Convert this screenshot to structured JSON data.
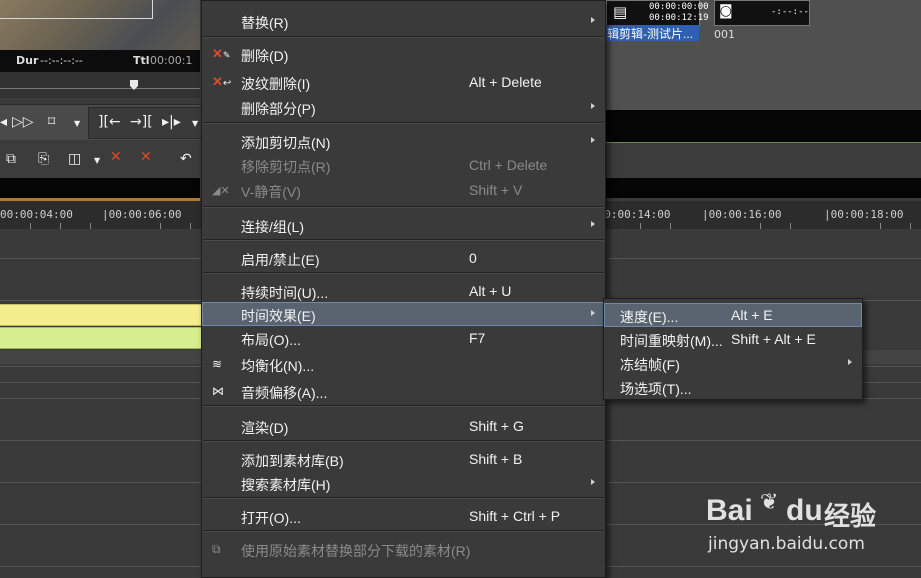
{
  "preview": {
    "dur_label": "Dur",
    "dur_value": "--:--:--:--",
    "ttl_label": "Ttl",
    "ttl_value": "00:00:1"
  },
  "ruler": {
    "labels": [
      "00:00:04:00",
      "|00:00:06:00",
      "|00:00:14:00",
      "|00:00:16:00",
      "|00:00:18:00"
    ]
  },
  "thumbnails": [
    {
      "time1": "00:00:00:00",
      "time2": "00:00:12:19",
      "caption": "辑剪辑-测试片..."
    },
    {
      "time1": "-:--:--",
      "time2": "",
      "caption": "001"
    }
  ],
  "context_menu": {
    "items": [
      {
        "label": "替换(R)",
        "shortcut": "",
        "submenu": true,
        "disabled": false,
        "icon": ""
      },
      {
        "label": "删除(D)",
        "shortcut": "",
        "submenu": false,
        "disabled": false,
        "icon": "delete-icon"
      },
      {
        "label": "波纹删除(I)",
        "shortcut": "Alt + Delete",
        "submenu": false,
        "disabled": false,
        "icon": "ripple-delete-icon"
      },
      {
        "label": "删除部分(P)",
        "shortcut": "",
        "submenu": true,
        "disabled": false,
        "icon": ""
      },
      {
        "label": "添加剪切点(N)",
        "shortcut": "",
        "submenu": true,
        "disabled": false,
        "icon": ""
      },
      {
        "label": "移除剪切点(R)",
        "shortcut": "Ctrl + Delete",
        "submenu": false,
        "disabled": true,
        "icon": ""
      },
      {
        "label": "V-静音(V)",
        "shortcut": "Shift + V",
        "submenu": false,
        "disabled": true,
        "icon": "mute-icon"
      },
      {
        "label": "连接/组(L)",
        "shortcut": "",
        "submenu": true,
        "disabled": false,
        "icon": ""
      },
      {
        "label": "启用/禁止(E)",
        "shortcut": "0",
        "submenu": false,
        "disabled": false,
        "icon": ""
      },
      {
        "label": "持续时间(U)...",
        "shortcut": "Alt + U",
        "submenu": false,
        "disabled": false,
        "icon": ""
      },
      {
        "label": "时间效果(E)",
        "shortcut": "",
        "submenu": true,
        "disabled": false,
        "icon": ""
      },
      {
        "label": "布局(O)...",
        "shortcut": "F7",
        "submenu": false,
        "disabled": false,
        "icon": ""
      },
      {
        "label": "均衡化(N)...",
        "shortcut": "",
        "submenu": false,
        "disabled": false,
        "icon": "equalize-icon"
      },
      {
        "label": "音频偏移(A)...",
        "shortcut": "",
        "submenu": false,
        "disabled": false,
        "icon": "audio-offset-icon"
      },
      {
        "label": "渲染(D)",
        "shortcut": "Shift + G",
        "submenu": false,
        "disabled": false,
        "icon": ""
      },
      {
        "label": "添加到素材库(B)",
        "shortcut": "Shift + B",
        "submenu": false,
        "disabled": false,
        "icon": ""
      },
      {
        "label": "搜索素材库(H)",
        "shortcut": "",
        "submenu": true,
        "disabled": false,
        "icon": ""
      },
      {
        "label": "打开(O)...",
        "shortcut": "Shift + Ctrl + P",
        "submenu": false,
        "disabled": false,
        "icon": ""
      },
      {
        "label": "使用原始素材替换部分下载的素材(R)",
        "shortcut": "",
        "submenu": false,
        "disabled": true,
        "icon": "replace-source-icon"
      }
    ]
  },
  "submenu": {
    "items": [
      {
        "label": "速度(E)...",
        "shortcut": "Alt + E",
        "submenu": false
      },
      {
        "label": "时间重映射(M)...",
        "shortcut": "Shift + Alt + E",
        "submenu": false
      },
      {
        "label": "冻结帧(F)",
        "shortcut": "",
        "submenu": true
      },
      {
        "label": "场选项(T)...",
        "shortcut": "",
        "submenu": false
      }
    ]
  },
  "watermark": {
    "brand": "Bai",
    "brand2": "du",
    "product": "经验",
    "url": "jingyan.baidu.com"
  }
}
